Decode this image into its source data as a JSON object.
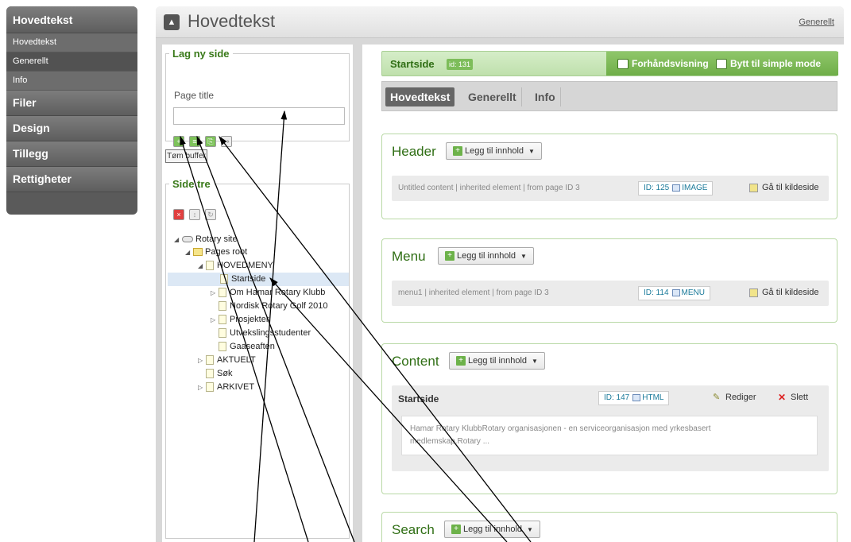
{
  "sidebar": {
    "sections": [
      {
        "label": "Hovedtekst"
      },
      {
        "label": "Filer"
      },
      {
        "label": "Design"
      },
      {
        "label": "Tillegg"
      },
      {
        "label": "Rettigheter"
      }
    ],
    "subitems": [
      {
        "label": "Hovedtekst"
      },
      {
        "label": "Generellt"
      },
      {
        "label": "Info"
      }
    ]
  },
  "header": {
    "title": "Hovedtekst",
    "link": "Generellt",
    "icon": "up-arrow-icon"
  },
  "newpage": {
    "legend": "Lag ny side",
    "label": "Page title",
    "value": "",
    "flush": "Tøm buffer"
  },
  "tree": {
    "legend": "Side tre",
    "items": [
      {
        "label": "Rotary site"
      },
      {
        "label": "Pages root"
      },
      {
        "label": "HOVEDMENY"
      },
      {
        "label": "Startside"
      },
      {
        "label": "Om Hamar Rotary Klubb"
      },
      {
        "label": "Nordisk Rotary Golf 2010"
      },
      {
        "label": "Prosjekter"
      },
      {
        "label": "Utvekslingsstudenter"
      },
      {
        "label": "Gaaseaften"
      },
      {
        "label": "AKTUELT"
      },
      {
        "label": "Søk"
      },
      {
        "label": "ARKIVET"
      }
    ]
  },
  "page": {
    "name": "Startside",
    "id": "id: 131",
    "preview": "Forhåndsvisning",
    "simple": "Bytt til simple mode"
  },
  "tabs": [
    {
      "label": "Hovedtekst"
    },
    {
      "label": "Generellt"
    },
    {
      "label": "Info"
    }
  ],
  "areas": {
    "header": {
      "title": "Header",
      "add": "Legg til innhold",
      "item": "Untitled content | inherited element | from page ID 3",
      "id": "ID: 125",
      "type": "IMAGE",
      "goto": "Gå til kildeside"
    },
    "menu": {
      "title": "Menu",
      "add": "Legg til innhold",
      "item": "menu1 | inherited element | from page ID 3",
      "id": "ID: 114",
      "type": "MENU",
      "goto": "Gå til kildeside"
    },
    "content": {
      "title": "Content",
      "add": "Legg til innhold",
      "item_title": "Startside",
      "id": "ID: 147",
      "type": "HTML",
      "edit": "Rediger",
      "delete": "Slett",
      "excerpt_line1": "Hamar Rotary KlubbRotary organisasjonen - en serviceorganisasjon med yrkesbasert",
      "excerpt_line2": "medlemskap.Rotary ..."
    },
    "search": {
      "title": "Search",
      "add": "Legg til innhold"
    }
  },
  "colors": {
    "accent_green": "#2f6e14",
    "sidebar_gray": "#5a5a5a"
  }
}
